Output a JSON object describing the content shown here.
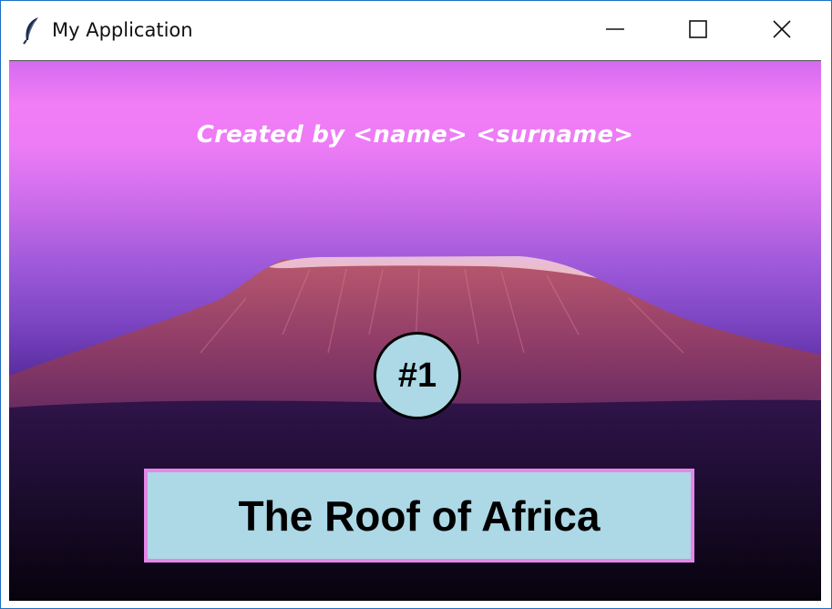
{
  "window": {
    "title": "My Application",
    "icon": "feather-icon",
    "controls": [
      "minimize-icon",
      "maximize-icon",
      "close-icon"
    ],
    "border_color": "#1f6fc5"
  },
  "canvas": {
    "credit_text": "Created by <name> <surname>",
    "badge_text": "#1",
    "banner_text": "The Roof of Africa",
    "colors": {
      "badge_fill": "#add8e6",
      "banner_fill": "#add8e6",
      "banner_border": "#e586e8",
      "credit_text": "#ffffff"
    }
  }
}
